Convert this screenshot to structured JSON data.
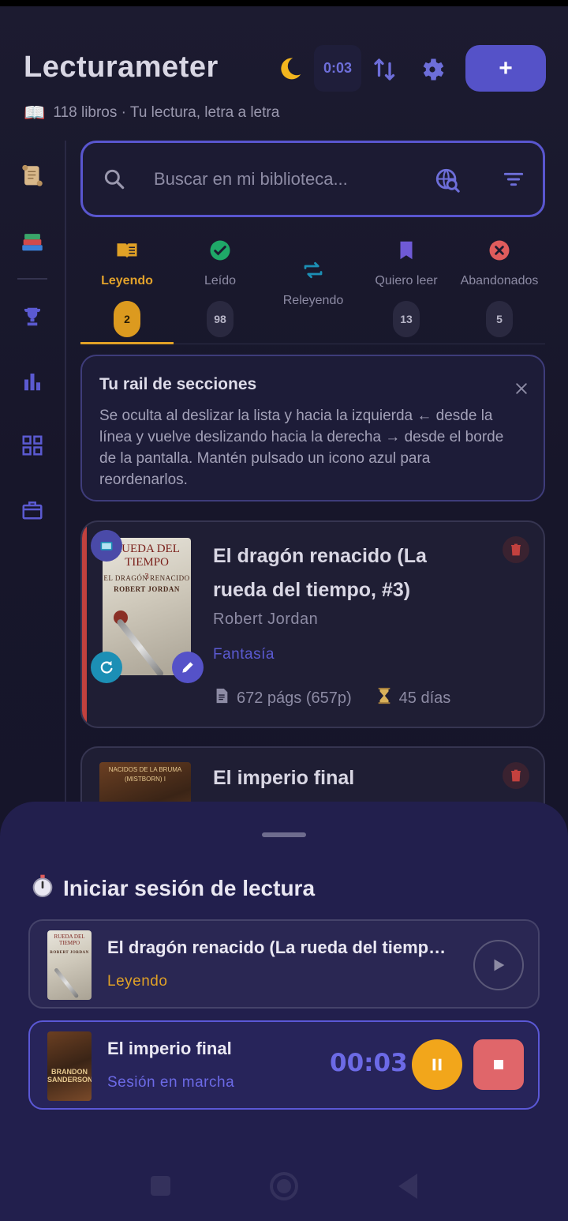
{
  "header": {
    "title": "Lecturameter",
    "subtitle_icon": "📖",
    "subtitle": "118 libros · Tu lectura, letra a letra",
    "timer_chip": "0:03",
    "add_label": "+"
  },
  "search": {
    "placeholder": "Buscar en mi biblioteca..."
  },
  "tabs": [
    {
      "label": "Leyendo",
      "count": "2",
      "icon": "open-book-icon",
      "color": "#e0a126",
      "active": true
    },
    {
      "label": "Leído",
      "count": "98",
      "icon": "check-circle-icon",
      "color": "#1fa868"
    },
    {
      "label": "Releyendo",
      "count": "",
      "icon": "repeat-icon",
      "color": "#1c8fb5"
    },
    {
      "label": "Quiero leer",
      "count": "13",
      "icon": "bookmark-icon",
      "color": "#6f5ad6"
    },
    {
      "label": "Abandonados",
      "count": "5",
      "icon": "x-circle-icon",
      "color": "#e05c5c"
    }
  ],
  "info_card": {
    "title": "Tu rail de secciones",
    "text": "Se oculta al deslizar la lista y hacia la izquierda ← desde la línea y vuelve deslizando hacia la derecha → desde el borde de la pantalla. Mantén pulsado un icono azul para reordenarlos."
  },
  "books": [
    {
      "title": "El dragón renacido (La rueda del tiempo, #3)",
      "author": "Robert Jordan",
      "genre": "Fantasía",
      "pages": "672 págs (657p)",
      "days": "45 días",
      "cover_title": "RUEDA DEL TIEMPO",
      "cover_number": "3",
      "cover_subtitle": "EL DRAGÓN RENACIDO",
      "cover_author": "ROBERT JORDAN"
    },
    {
      "title": "El imperio final",
      "cover_series": "NACIDOS DE LA BRUMA (MISTBORN) I",
      "cover_author": "BRANDON SANDERSON"
    }
  ],
  "sheet": {
    "title": "Iniciar sesión de lectura",
    "sessions": [
      {
        "title": "El dragón renacido (La rueda del tiempo, #3)",
        "status": "Leyendo",
        "status_color": "#e0a126"
      },
      {
        "title": "El imperio final",
        "status": "Sesión en marcha",
        "status_color": "#6c6ae6",
        "timer": "00:03"
      }
    ]
  },
  "colors": {
    "accent": "#5552c8",
    "reading": "#e0a126",
    "danger": "#c2413e"
  }
}
